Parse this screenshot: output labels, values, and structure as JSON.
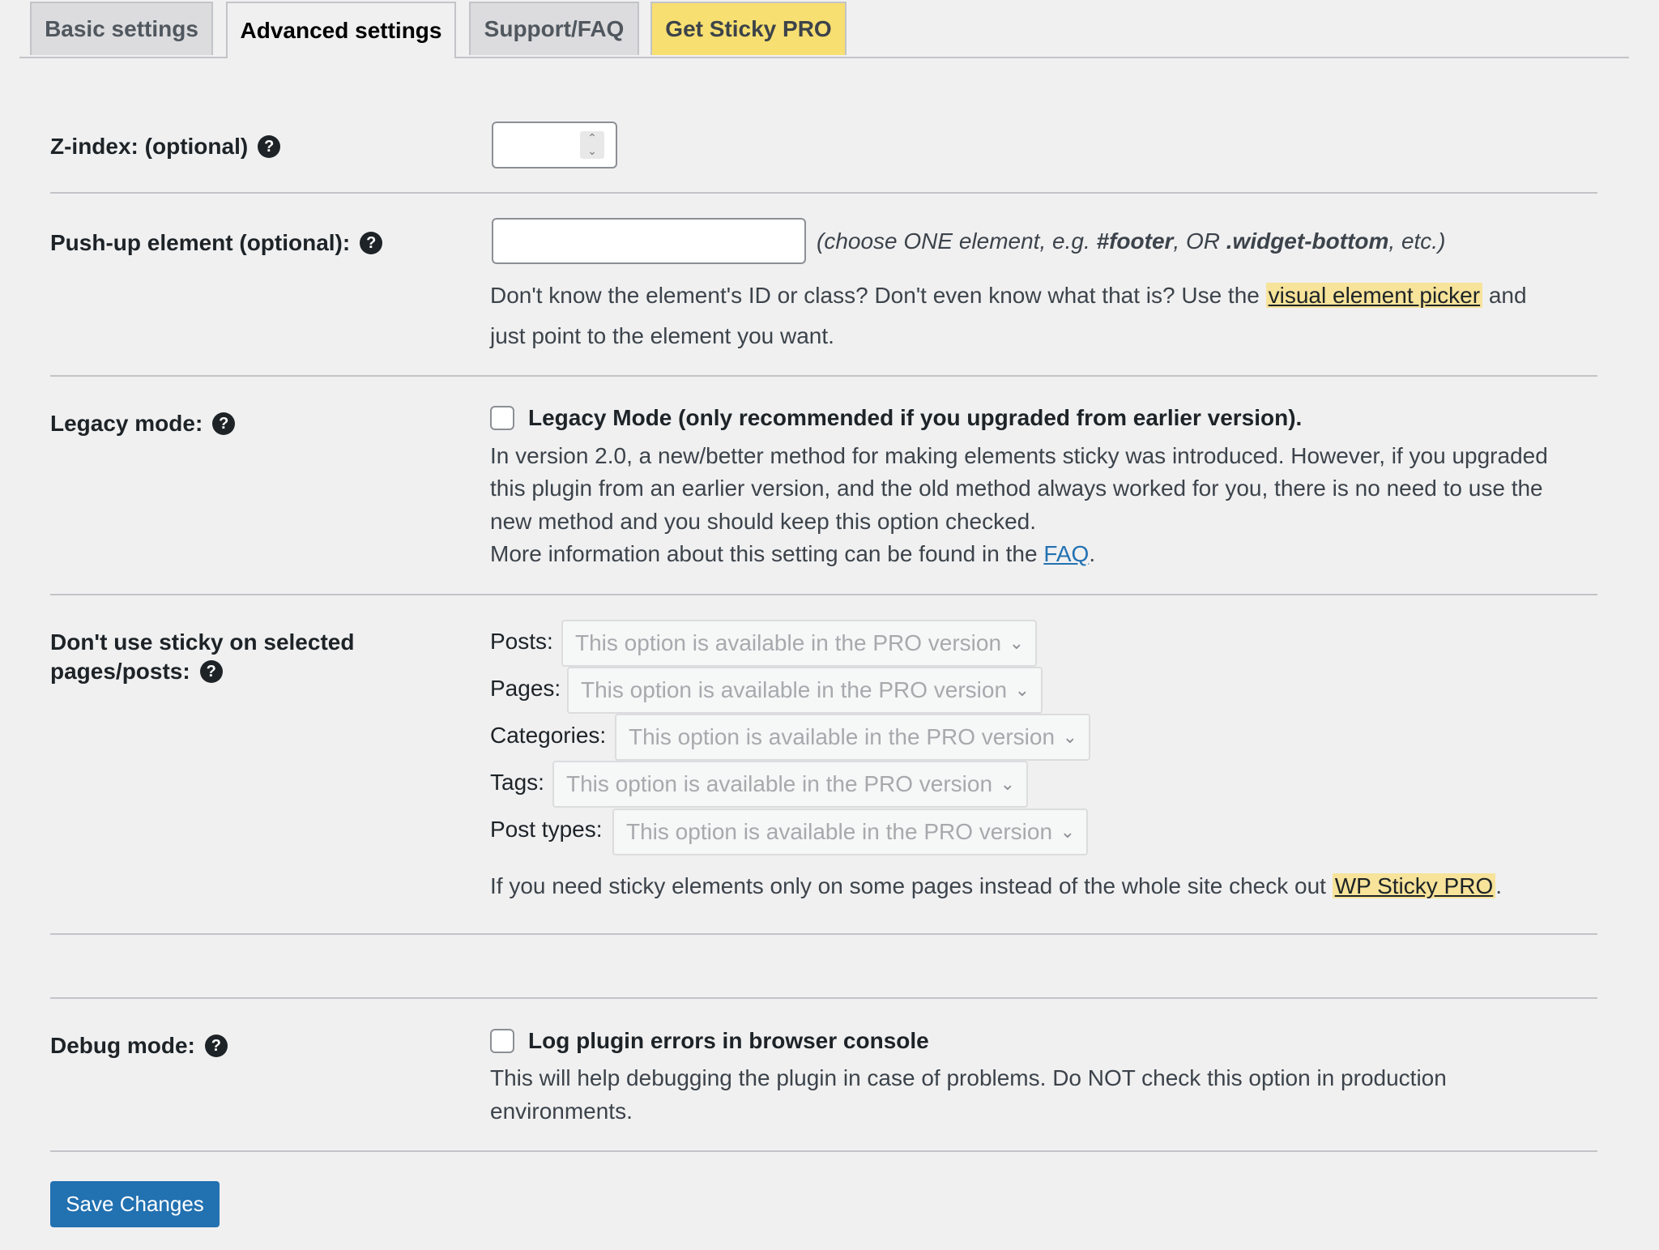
{
  "tabs": [
    {
      "label": "Basic settings",
      "active": false
    },
    {
      "label": "Advanced settings",
      "active": true
    },
    {
      "label": "Support/FAQ",
      "active": false
    },
    {
      "label": "Get Sticky PRO",
      "active": false
    }
  ],
  "zindex": {
    "label": "Z-index: (optional)",
    "value": ""
  },
  "pushup": {
    "label": "Push-up element (optional):",
    "value": "",
    "hint_prefix": "(choose ONE element, e.g. ",
    "hint_ex1": "#footer",
    "hint_mid": ", OR ",
    "hint_ex2": ".widget-bottom",
    "hint_suffix": ", etc.)",
    "help_line1_prefix": "Don't know the element's ID or class? Don't even know what that is? Use the ",
    "help_link": "visual element picker",
    "help_line1_suffix": " and",
    "help_line2": "just point to the element you want."
  },
  "legacy": {
    "label": "Legacy mode:",
    "checkbox_label": "Legacy Mode (only recommended if you upgraded from earlier version).",
    "checked": false,
    "desc_lines": [
      "In version 2.0, a new/better method for making elements sticky was introduced. However, if you upgraded",
      "this plugin from an earlier version, and the old method always worked for you, there is no need to use the",
      "new method and you should keep this option checked."
    ],
    "more_prefix": "More information about this setting can be found in the ",
    "more_link": "FAQ",
    "more_suffix": "."
  },
  "exclude": {
    "label_line1": "Don't use sticky on selected",
    "label_line2": "pages/posts:",
    "rows": [
      {
        "label": "Posts:",
        "value": "This option is available in the PRO version"
      },
      {
        "label": "Pages:",
        "value": "This option is available in the PRO version"
      },
      {
        "label": "Categories:",
        "value": "This option is available in the PRO version"
      },
      {
        "label": "Tags:",
        "value": "This option is available in the PRO version"
      },
      {
        "label": "Post types:",
        "value": "This option is available in the PRO version"
      }
    ],
    "info_prefix": "If you need sticky elements only on some pages instead of the whole site check out ",
    "info_link": "WP Sticky PRO",
    "info_suffix": "."
  },
  "debug": {
    "label": "Debug mode:",
    "checkbox_label": "Log plugin errors in browser console",
    "checked": false,
    "desc_lines": [
      "This will help debugging the plugin in case of problems. Do NOT check this option in production",
      "environments."
    ]
  },
  "icons": {
    "help": "?",
    "chevron": "⌄",
    "spin_up": "⌃",
    "spin_down": "⌄"
  },
  "save_label": "Save Changes"
}
